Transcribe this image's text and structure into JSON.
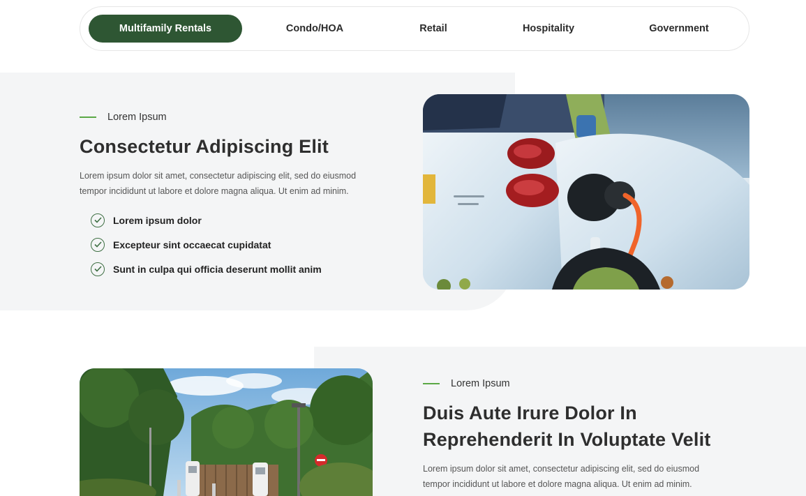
{
  "tabs": [
    {
      "label": "Multifamily Rentals",
      "active": true
    },
    {
      "label": "Condo/HOA",
      "active": false
    },
    {
      "label": "Retail",
      "active": false
    },
    {
      "label": "Hospitality",
      "active": false
    },
    {
      "label": "Government",
      "active": false
    }
  ],
  "section1": {
    "eyebrow": "Lorem Ipsum",
    "heading": "Consectetur Adipiscing Elit",
    "paragraph_line1": "Lorem ipsum dolor sit amet, consectetur adipiscing elit, sed do eiusmod",
    "paragraph_line2": "tempor incididunt ut labore et dolore magna aliqua. Ut enim ad minim.",
    "checks": [
      "Lorem ipsum dolor",
      "Excepteur sint occaecat cupidatat",
      "Sunt in culpa qui officia deserunt mollit anim"
    ],
    "image_icon": "ev-car-charging-photo"
  },
  "section2": {
    "eyebrow": "Lorem Ipsum",
    "heading_line1": "Duis Aute Irure Dolor In",
    "heading_line2": "Reprehenderit In Voluptate Velit",
    "paragraph_line1": "Lorem ipsum dolor sit amet, consectetur adipiscing elit, sed do eiusmod",
    "paragraph_line2": "tempor incididunt ut labore et dolore magna aliqua. Ut enim ad minim.",
    "image_icon": "charging-station-photo"
  },
  "colors": {
    "accent": "#2e5633",
    "eyebrow_line": "#5aa845",
    "section_bg": "#f4f5f6"
  }
}
